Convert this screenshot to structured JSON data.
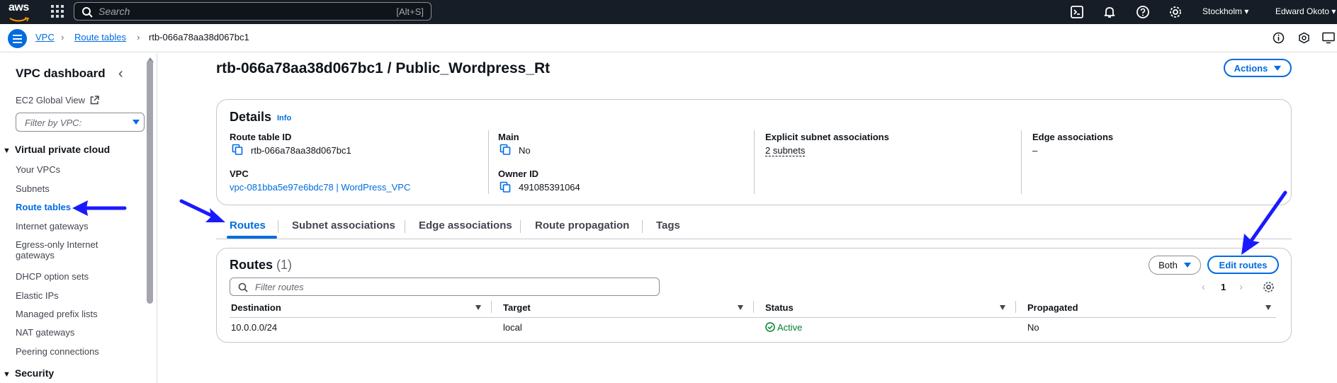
{
  "topbar": {
    "logo_text": "aws",
    "search_placeholder": "Search",
    "search_shortcut": "[Alt+S]",
    "region": "Stockholm ▾",
    "user": "Edward Okoto ▾"
  },
  "breadcrumb": {
    "items": [
      "VPC",
      "Route tables",
      "rtb-066a78aa38d067bc1"
    ]
  },
  "sidebar": {
    "title": "VPC dashboard",
    "ec2_global_view": "EC2 Global View",
    "filter_placeholder": "Filter by VPC:",
    "section_vpc": "Virtual private cloud",
    "items": [
      "Your VPCs",
      "Subnets",
      "Route tables",
      "Internet gateways",
      "Egress-only Internet",
      "gateways",
      "DHCP option sets",
      "Elastic IPs",
      "Managed prefix lists",
      "NAT gateways",
      "Peering connections"
    ],
    "section_security": "Security",
    "active_item": "Route tables"
  },
  "page": {
    "title": "rtb-066a78aa38d067bc1 / Public_Wordpress_Rt",
    "actions_label": "Actions"
  },
  "details": {
    "heading": "Details",
    "info": "Info",
    "route_table_id_label": "Route table ID",
    "route_table_id": "rtb-066a78aa38d067bc1",
    "main_label": "Main",
    "main_value": "No",
    "explicit_label": "Explicit subnet associations",
    "explicit_value": "2 subnets",
    "edge_label": "Edge associations",
    "edge_value": "–",
    "vpc_label": "VPC",
    "vpc_value": "vpc-081bba5e97e6bdc78 | WordPress_VPC",
    "owner_label": "Owner ID",
    "owner_value": "491085391064"
  },
  "tabs": [
    "Routes",
    "Subnet associations",
    "Edge associations",
    "Route propagation",
    "Tags"
  ],
  "routes": {
    "heading": "Routes",
    "count": "(1)",
    "filter_select": "Both",
    "edit_label": "Edit routes",
    "search_placeholder": "Filter routes",
    "page": "1",
    "columns": [
      "Destination",
      "Target",
      "Status",
      "Propagated"
    ],
    "rows": [
      {
        "destination": "10.0.0.0/24",
        "target": "local",
        "status": "Active",
        "propagated": "No"
      }
    ]
  },
  "colors": {
    "accent": "#006ce0",
    "topbar": "#161d26",
    "success": "#00802f",
    "annotation_arrow": "#1a1aff"
  }
}
